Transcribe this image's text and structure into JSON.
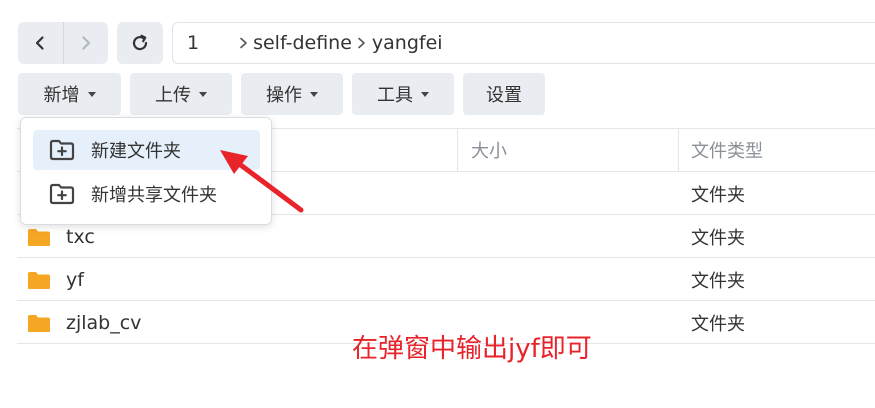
{
  "navigation": {
    "back_icon": "chevron-left-icon",
    "forward_icon": "chevron-right-icon",
    "refresh_icon": "refresh-icon"
  },
  "path": {
    "segments": [
      "1",
      "self-define",
      "yangfei"
    ]
  },
  "toolbar": {
    "new_label": "新增",
    "upload_label": "上传",
    "action_label": "操作",
    "tools_label": "工具",
    "settings_label": "设置"
  },
  "table": {
    "headers": {
      "name": "",
      "size": "大小",
      "type": "文件类型"
    },
    "rows": [
      {
        "name": "",
        "type": "文件夹"
      },
      {
        "name": "txc",
        "type": "文件夹"
      },
      {
        "name": "yf",
        "type": "文件夹"
      },
      {
        "name": "zjlab_cv",
        "type": "文件夹"
      }
    ]
  },
  "dropdown": {
    "items": [
      {
        "label": "新建文件夹",
        "icon": "folder-plus-icon",
        "active": true
      },
      {
        "label": "新增共享文件夹",
        "icon": "folder-plus-icon",
        "active": false
      }
    ]
  },
  "annotation": {
    "text": "在弹窗中输出jyf即可",
    "color": "#e8232a"
  },
  "colors": {
    "folder": "#f5a623",
    "button_bg": "#e9ecf1",
    "menu_active_bg": "#e6f0fb"
  }
}
